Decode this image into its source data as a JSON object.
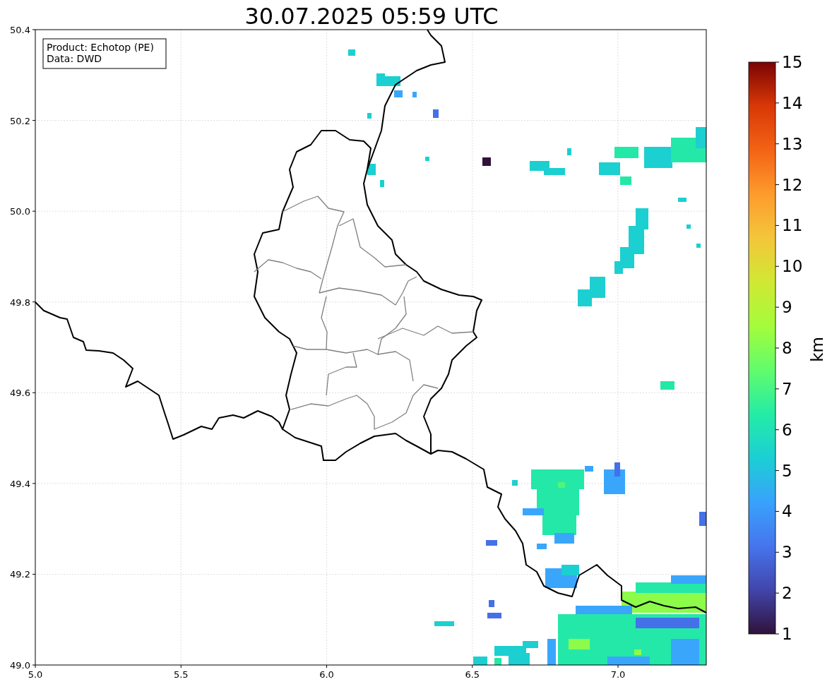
{
  "title": "30.07.2025 05:59 UTC",
  "info_box": {
    "lines": [
      "Product: Echotop (PE)",
      "Data: DWD"
    ]
  },
  "map": {
    "x_ticks": [
      "5.0",
      "5.5",
      "6.0",
      "6.5",
      "7.0"
    ],
    "y_ticks": [
      "50.4",
      "50.2",
      "50.0",
      "49.8",
      "49.6",
      "49.4",
      "49.2",
      "49.0"
    ]
  },
  "colorbar": {
    "label": "km",
    "ticks": [
      "15",
      "14",
      "13",
      "12",
      "11",
      "10",
      "9",
      "8",
      "7",
      "6",
      "5",
      "4",
      "3",
      "2",
      "1"
    ]
  }
}
